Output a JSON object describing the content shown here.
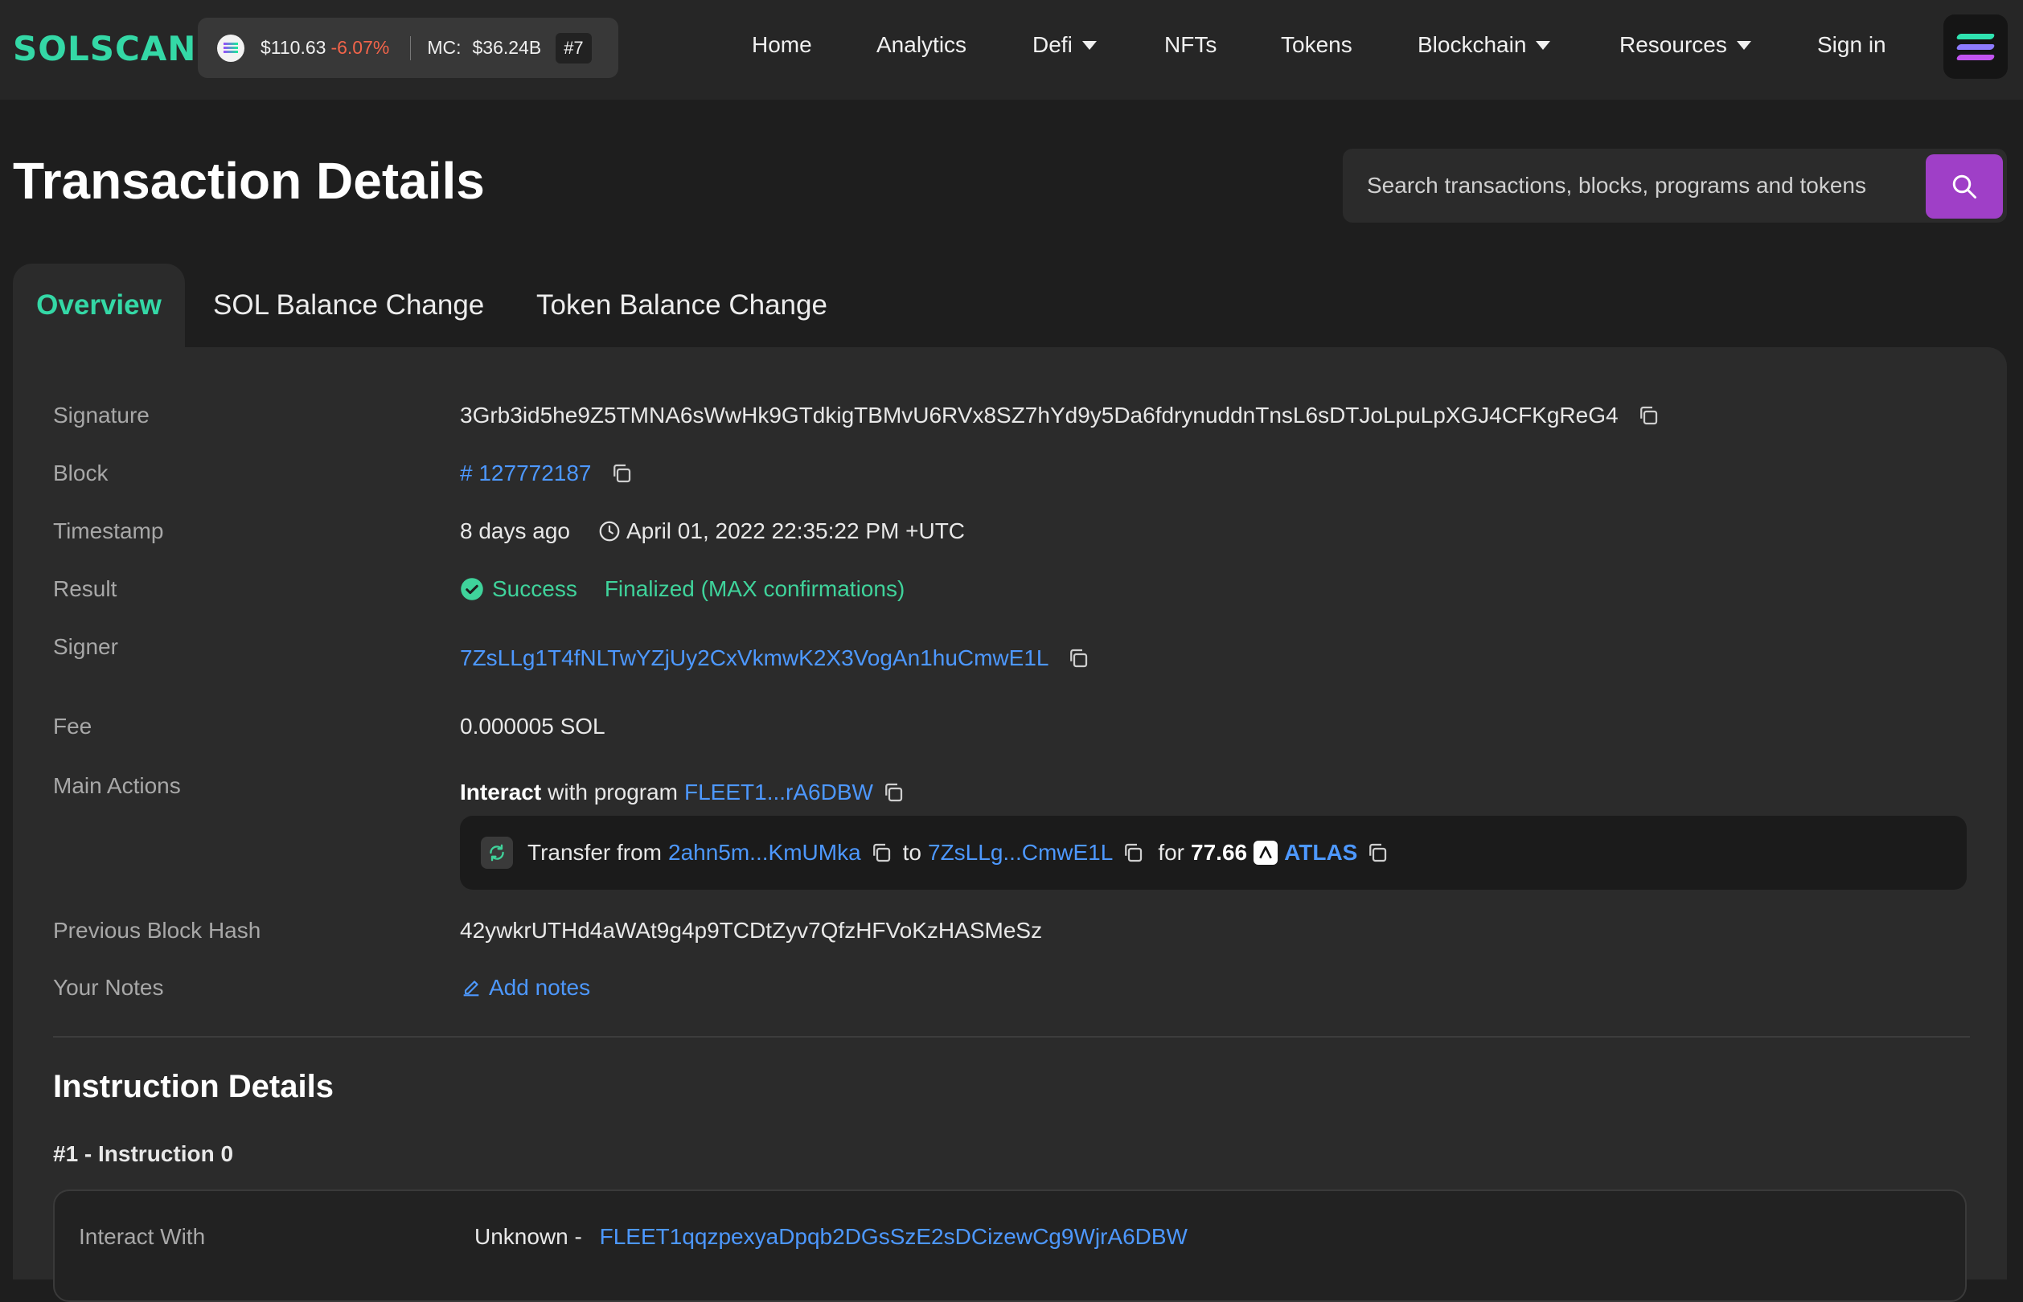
{
  "nav": {
    "logo": "SOLSCAN",
    "price": "$110.63",
    "change": "-6.07%",
    "mc_label": "MC:",
    "mc_value": "$36.24B",
    "rank": "#7",
    "items": [
      "Home",
      "Analytics",
      "Defi",
      "NFTs",
      "Tokens",
      "Blockchain",
      "Resources",
      "Sign in"
    ]
  },
  "header": {
    "title": "Transaction Details",
    "search_placeholder": "Search transactions, blocks, programs and tokens"
  },
  "tabs": [
    "Overview",
    "SOL Balance Change",
    "Token Balance Change"
  ],
  "overview": {
    "labels": {
      "signature": "Signature",
      "block": "Block",
      "timestamp": "Timestamp",
      "result": "Result",
      "signer": "Signer",
      "fee": "Fee",
      "main_actions": "Main Actions",
      "prev_hash": "Previous Block Hash",
      "notes": "Your Notes"
    },
    "signature": "3Grb3id5he9Z5TMNA6sWwHk9GTdkigTBMvU6RVx8SZ7hYd9y5Da6fdrynuddnTnsL6sDTJoLpuLpXGJ4CFKgReG4",
    "block": "# 127772187",
    "timestamp_relative": "8 days ago",
    "timestamp_absolute": "April 01, 2022 22:35:22 PM +UTC",
    "result_status": "Success",
    "result_confirmation": "Finalized (MAX confirmations)",
    "signer": "7ZsLLg1T4fNLTwYZjUy2CxVkmwK2X3VogAn1huCmwE1L",
    "fee": "0.000005 SOL",
    "action_verb": "Interact",
    "action_with": "with program",
    "action_program": "FLEET1...rA6DBW",
    "transfer": {
      "from_label": "Transfer from",
      "from": "2ahn5m...KmUMka",
      "to_label": "to",
      "to": "7ZsLLg...CmwE1L",
      "for_label": "for",
      "amount": "77.66",
      "token": "ATLAS"
    },
    "prev_hash": "42ywkrUTHd4aWAt9g4p9TCDtZyv7QfzHFVoKzHASMeSz",
    "notes_link": "Add notes"
  },
  "instructions": {
    "title": "Instruction Details",
    "item_label": "#1 - Instruction 0",
    "interact_label": "Interact With",
    "interact_prefix": "Unknown -",
    "interact_program": "FLEET1qqzpexyaDpqb2DGsSzE2sDCizewCg9WjrA6DBW"
  },
  "colors": {
    "accent": "#34d8a6",
    "link": "#4d98ff",
    "search_button": "#9f3fc7",
    "negative": "#f2644a"
  }
}
